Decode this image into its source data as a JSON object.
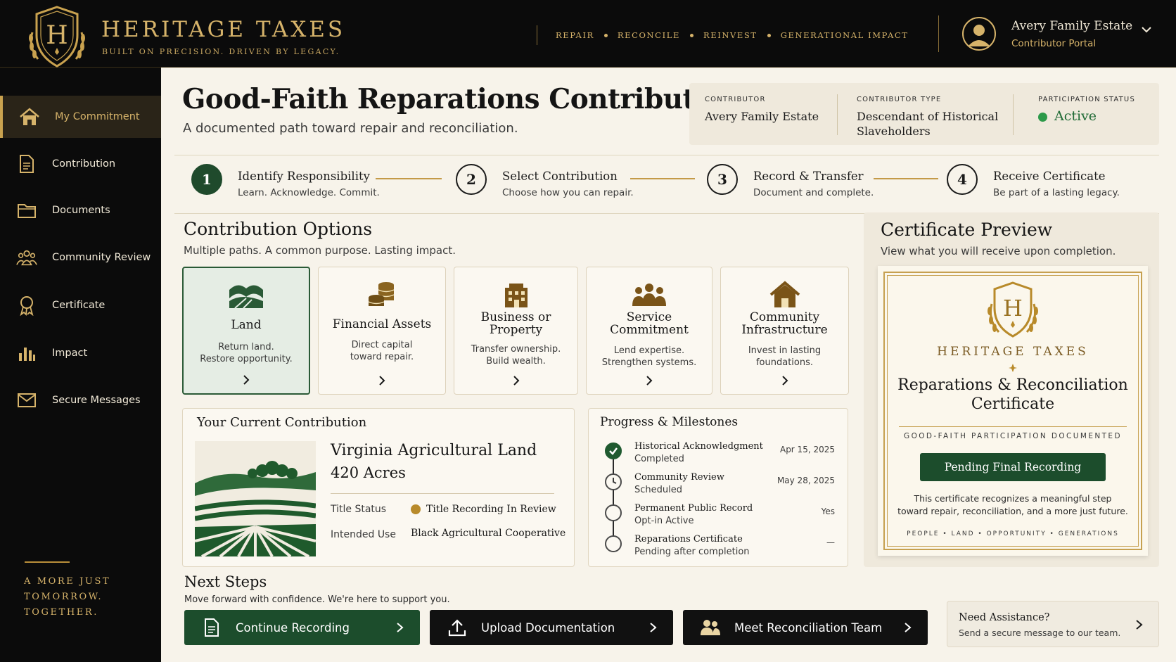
{
  "brand": {
    "name": "HERITAGE TAXES",
    "tagline": "BUILT ON PRECISION. DRIVEN BY LEGACY.",
    "accent": "#c9a24f"
  },
  "topnav": [
    "REPAIR",
    "RECONCILE",
    "REINVEST",
    "GENERATIONAL IMPACT"
  ],
  "user": {
    "name": "Avery Family Estate",
    "role": "Contributor Portal",
    "icon": "user-avatar-icon"
  },
  "sidebar": {
    "items": [
      {
        "label": "My Commitment",
        "icon": "home-icon",
        "active": true
      },
      {
        "label": "Contribution",
        "icon": "document-icon"
      },
      {
        "label": "Documents",
        "icon": "folder-icon"
      },
      {
        "label": "Community Review",
        "icon": "people-icon"
      },
      {
        "label": "Certificate",
        "icon": "award-icon"
      },
      {
        "label": "Impact",
        "icon": "bar-chart-icon"
      },
      {
        "label": "Secure Messages",
        "icon": "envelope-icon"
      }
    ],
    "motto": [
      "A MORE JUST",
      "TOMORROW.",
      "TOGETHER."
    ]
  },
  "page": {
    "title": "Good-Faith Reparations Contribution",
    "subtitle": "A documented path toward repair and reconciliation."
  },
  "info": {
    "contributor_label": "CONTRIBUTOR",
    "contributor": "Avery Family Estate",
    "type_label": "CONTRIBUTOR TYPE",
    "type_line1": "Descendant of Historical",
    "type_line2": "Slaveholders",
    "status_label": "PARTICIPATION STATUS",
    "status": "Active",
    "status_color": "#2d9a4a"
  },
  "steps": [
    {
      "num": "1",
      "title": "Identify Responsibility",
      "desc": "Learn. Acknowledge. Commit.",
      "done": true
    },
    {
      "num": "2",
      "title": "Select Contribution",
      "desc": "Choose how you can repair."
    },
    {
      "num": "3",
      "title": "Record & Transfer",
      "desc": "Document and complete."
    },
    {
      "num": "4",
      "title": "Receive Certificate",
      "desc": "Be part of a lasting legacy."
    }
  ],
  "options": {
    "title": "Contribution Options",
    "subtitle": "Multiple paths. A common purpose. Lasting impact.",
    "items": [
      {
        "t1": "Land",
        "t2": "",
        "d1": "Return land.",
        "d2": "Restore opportunity.",
        "icon": "land-icon",
        "selected": true
      },
      {
        "t1": "Financial Assets",
        "t2": "",
        "d1": "Direct capital",
        "d2": "toward repair.",
        "icon": "coins-icon"
      },
      {
        "t1": "Business or",
        "t2": "Property",
        "d1": "Transfer ownership.",
        "d2": "Build wealth.",
        "icon": "building-icon"
      },
      {
        "t1": "Service",
        "t2": "Commitment",
        "d1": "Lend expertise.",
        "d2": "Strengthen systems.",
        "icon": "group-icon"
      },
      {
        "t1": "Community",
        "t2": "Infrastructure",
        "d1": "Invest in lasting",
        "d2": "foundations.",
        "icon": "house-icon"
      }
    ]
  },
  "current": {
    "title": "Your Current Contribution",
    "name": "Virginia Agricultural Land",
    "acres": "420 Acres",
    "title_status_label": "Title Status",
    "title_status": "Title Recording In Review",
    "use_label": "Intended Use",
    "use": "Black Agricultural Cooperative"
  },
  "progress": {
    "title": "Progress & Milestones",
    "items": [
      {
        "title": "Historical Acknowledgment",
        "status": "Completed",
        "date": "Apr 15, 2025",
        "icon": "check-icon"
      },
      {
        "title": "Community Review",
        "status": "Scheduled",
        "date": "May 28, 2025",
        "icon": "clock-icon"
      },
      {
        "title": "Permanent Public Record",
        "status": "Opt-in Active",
        "date": "Yes",
        "icon": "circle-icon"
      },
      {
        "title": "Reparations Certificate",
        "status": "Pending after completion",
        "date": "—",
        "icon": "circle-icon"
      }
    ]
  },
  "certificate": {
    "title": "Certificate Preview",
    "subtitle": "View what you will receive upon completion.",
    "brand": "HERITAGE TAXES",
    "name1": "Reparations & Reconciliation",
    "name2": "Certificate",
    "doc": "GOOD-FAITH PARTICIPATION DOCUMENTED",
    "pending": "Pending Final Recording",
    "text1": "This certificate recognizes a meaningful step",
    "text2": "toward repair, reconciliation, and a more just future.",
    "footer": "PEOPLE • LAND • OPPORTUNITY • GENERATIONS"
  },
  "next": {
    "title": "Next Steps",
    "subtitle": "Move forward with confidence. We're here to support you.",
    "buttons": [
      {
        "label": "Continue Recording",
        "icon": "document-icon",
        "color": "#1c4d2c"
      },
      {
        "label": "Upload Documentation",
        "icon": "upload-icon",
        "color": "#111111"
      },
      {
        "label": "Meet Reconciliation Team",
        "icon": "people-icon",
        "color": "#111111"
      }
    ]
  },
  "assist": {
    "title": "Need Assistance?",
    "subtitle": "Send a secure message to our team."
  }
}
